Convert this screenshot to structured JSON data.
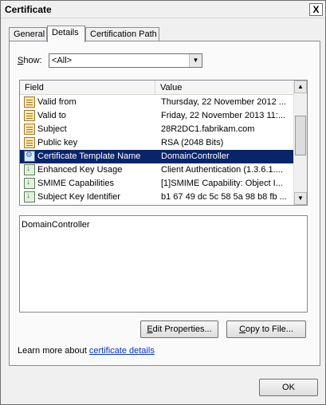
{
  "window": {
    "title": "Certificate",
    "close_glyph": "X"
  },
  "tabs": [
    {
      "label": "General"
    },
    {
      "label": "Details"
    },
    {
      "label": "Certification Path"
    }
  ],
  "show": {
    "label_underlined": "S",
    "label_rest": "how:",
    "selected": "<All>"
  },
  "list": {
    "columns": {
      "field": "Field",
      "value": "Value"
    },
    "rows": [
      {
        "field": "Valid from",
        "value": "Thursday, 22 November 2012 ..."
      },
      {
        "field": "Valid to",
        "value": "Friday, 22 November 2013 11:..."
      },
      {
        "field": "Subject",
        "value": "28R2DC1.fabrikam.com"
      },
      {
        "field": "Public key",
        "value": "RSA (2048 Bits)"
      },
      {
        "field": "Certificate Template Name",
        "value": "DomainController"
      },
      {
        "field": "Enhanced Key Usage",
        "value": "Client Authentication (1.3.6.1...."
      },
      {
        "field": "SMIME Capabilities",
        "value": "[1]SMIME Capability: Object I..."
      },
      {
        "field": "Subject Key Identifier",
        "value": "b1 67 49 dc 5c 58 5a 98 b8 fb ..."
      }
    ]
  },
  "detail": {
    "text": "DomainController"
  },
  "buttons": {
    "edit_properties": {
      "u": "E",
      "rest": "dit Properties..."
    },
    "copy_to_file": {
      "u": "C",
      "rest": "opy to File..."
    },
    "ok": "OK"
  },
  "learn": {
    "prefix": "Learn more about ",
    "link": "certificate details"
  },
  "colors": {
    "selection": "#0a246a",
    "link": "#0033cc"
  }
}
